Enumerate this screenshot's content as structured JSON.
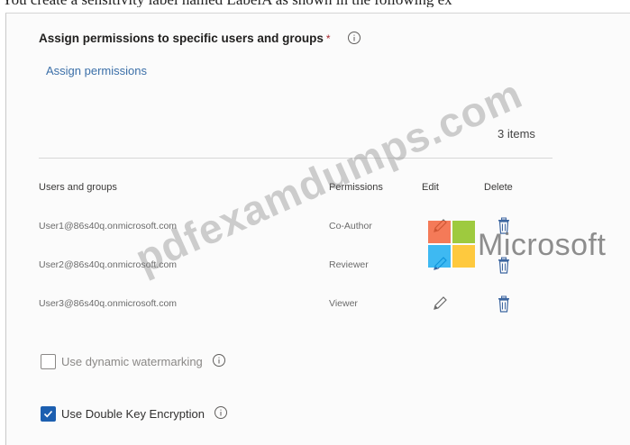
{
  "caption_fragment": "You create a sensitivity label named LabelA as shown in the following ex",
  "section": {
    "title": "Assign permissions to specific users and groups",
    "required_mark": "*",
    "info_icon": "info-icon"
  },
  "assign_link": "Assign permissions",
  "items_count": "3 items",
  "table": {
    "headers": {
      "users": "Users and groups",
      "permissions": "Permissions",
      "edit": "Edit",
      "delete": "Delete"
    },
    "rows": [
      {
        "user": "User1@86s40q.onmicrosoft.com",
        "permission": "Co-Author",
        "edit_icon": "pencil-icon",
        "delete_icon": "trash-icon"
      },
      {
        "user": "User2@86s40q.onmicrosoft.com",
        "permission": "Reviewer",
        "edit_icon": "pencil-icon",
        "delete_icon": "trash-icon"
      },
      {
        "user": "User3@86s40q.onmicrosoft.com",
        "permission": "Viewer",
        "edit_icon": "pencil-icon",
        "delete_icon": "trash-icon"
      }
    ]
  },
  "options": {
    "dynamic_watermarking": {
      "label": "Use dynamic watermarking",
      "checked": false
    },
    "double_key_encryption": {
      "label": "Use Double Key Encryption",
      "checked": true
    }
  },
  "overlays": {
    "watermark_text": "pdfexamdumps.com",
    "brand_word": "Microsoft",
    "brand_colors": [
      "#f25022",
      "#7fba00",
      "#00a4ef",
      "#ffb900"
    ]
  },
  "colors": {
    "link": "#3b6fa8",
    "checkbox_checked": "#1c5fb0"
  }
}
